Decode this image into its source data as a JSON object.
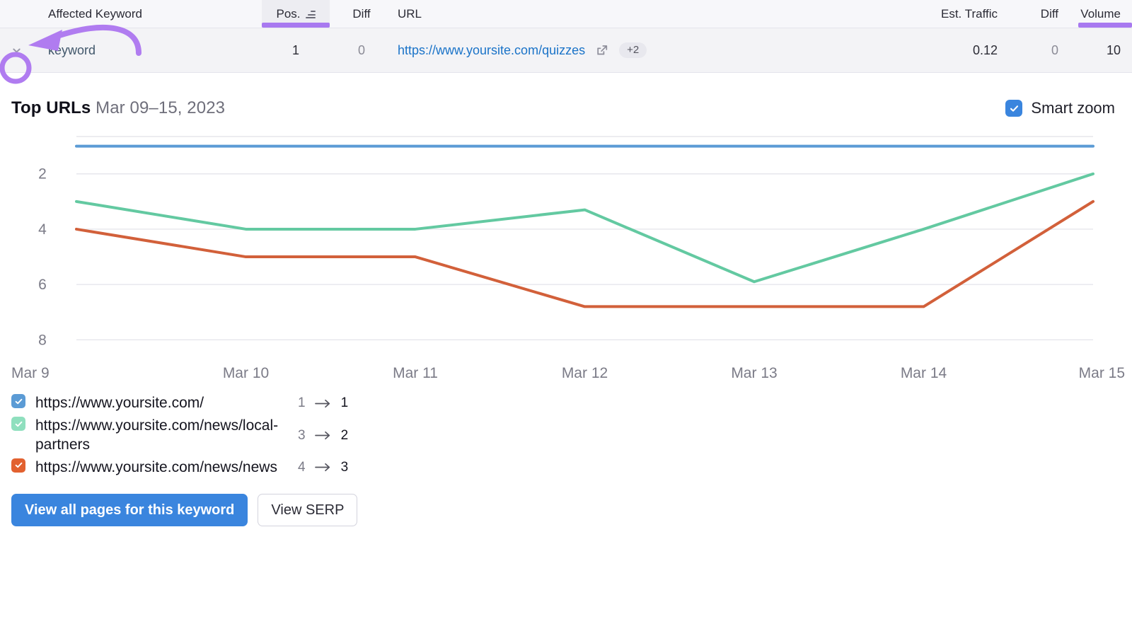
{
  "table": {
    "columns": [
      {
        "key": "affected_keyword",
        "label": "Affected Keyword"
      },
      {
        "key": "pos",
        "label": "Pos."
      },
      {
        "key": "diff",
        "label": "Diff"
      },
      {
        "key": "url",
        "label": "URL"
      },
      {
        "key": "est_traffic",
        "label": "Est. Traffic"
      },
      {
        "key": "diff2",
        "label": "Diff"
      },
      {
        "key": "volume",
        "label": "Volume"
      }
    ],
    "header": {
      "affected_keyword": "Affected Keyword",
      "pos": "Pos.",
      "diff": "Diff",
      "url": "URL",
      "est_traffic": "Est. Traffic",
      "diff2": "Diff",
      "volume": "Volume"
    },
    "row": {
      "keyword": "keyword",
      "pos": "1",
      "diff": "0",
      "url": "https://www.yoursite.com/quizzes",
      "url_badge": "+2",
      "est_traffic": "0.12",
      "diff2": "0",
      "volume": "10"
    },
    "sorted_column": "Pos.",
    "highlighted_column": "Volume",
    "accent_purple": "#a879f0"
  },
  "annotation": {
    "shape": "arrow-to-expand-chevron",
    "color": "#b07cf0"
  },
  "panel": {
    "title": "Top URLs",
    "date_range": "Mar 09–15, 2023",
    "smart_zoom": {
      "label": "Smart zoom",
      "checked": true,
      "color": "#3a85de"
    }
  },
  "chart_data": {
    "type": "line",
    "title": "Top URLs",
    "subtitle": "Mar 09–15, 2023",
    "xlabel": "",
    "ylabel": "",
    "x": [
      "Mar 9",
      "Mar 10",
      "Mar 11",
      "Mar 12",
      "Mar 13",
      "Mar 14",
      "Mar 15"
    ],
    "yticks": [
      2,
      4,
      6,
      8
    ],
    "ylim": [
      0.6,
      8.4
    ],
    "y_inverted": true,
    "grid": true,
    "legend_position": "below",
    "series": [
      {
        "name": "https://www.yoursite.com/",
        "color": "#5b9bd5",
        "values": [
          1,
          1,
          1,
          1,
          1,
          1,
          1
        ],
        "start": 1,
        "end": 1
      },
      {
        "name": "https://www.yoursite.com/news/local-partners",
        "color": "#63c9a1",
        "values": [
          3,
          4,
          4,
          3.3,
          5.9,
          4,
          2
        ],
        "start": 3,
        "end": 2
      },
      {
        "name": "https://www.yoursite.com/news/news",
        "color": "#d2603a",
        "values": [
          4,
          5,
          5,
          6.8,
          6.8,
          6.8,
          3
        ],
        "start": 4,
        "end": 3
      }
    ]
  },
  "legend": {
    "items": [
      {
        "url": "https://www.yoursite.com/",
        "color": "#5b9bd5",
        "checked": true,
        "from": "1",
        "to": "1"
      },
      {
        "url": "https://www.yoursite.com/news/local-partners",
        "color": "#8fdfbe",
        "checked": true,
        "from": "3",
        "to": "2"
      },
      {
        "url": "https://www.yoursite.com/news/news",
        "color": "#e2612f",
        "checked": true,
        "from": "4",
        "to": "3"
      }
    ]
  },
  "buttons": {
    "primary": "View all pages for this keyword",
    "secondary": "View SERP"
  }
}
